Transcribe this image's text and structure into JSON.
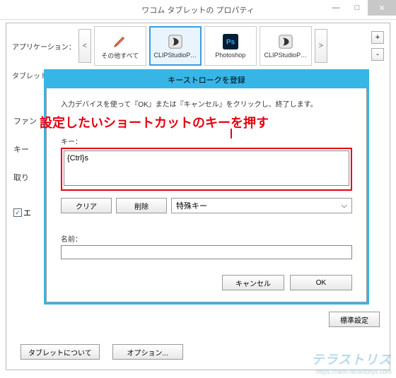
{
  "window": {
    "title": "ワコム タブレットの プロパティ"
  },
  "apps": {
    "label": "アプリケーション：",
    "nav_prev": "<",
    "nav_next": ">",
    "items": [
      {
        "label": "その他すべて"
      },
      {
        "label": "CLIPStudioP…"
      },
      {
        "label": "Photoshop"
      },
      {
        "label": "CLIPStudioP…"
      }
    ],
    "add": "+",
    "remove": "-"
  },
  "tabs_placeholder": "タブレット　ペン　マッピング　オンスクリーンコントロール",
  "side": {
    "fun": "ファン",
    "key": "キー",
    "drop": "取り",
    "check": "エ"
  },
  "dialog": {
    "title": "キーストロークを登録",
    "instruction": "入力デバイスを使って『OK』または『キャンセル』をクリックし、終了します。",
    "key_label": "キー：",
    "key_value": "{Ctrl}s",
    "clear": "クリア",
    "delete": "削除",
    "special": "特殊キー",
    "name_label": "名前：",
    "name_value": "",
    "cancel": "キャンセル",
    "ok": "OK"
  },
  "annotation": {
    "text": "設定したいショートカットのキーを押す"
  },
  "buttons": {
    "default_settings": "標準設定",
    "about_tablet": "タブレットについて",
    "options": "オプション..."
  },
  "watermark": {
    "logo": "テラストリス",
    "url": "https://raon-terastorys.com"
  }
}
